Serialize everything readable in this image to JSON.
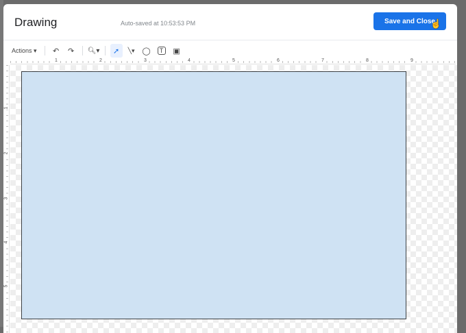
{
  "dialog": {
    "title": "Drawing",
    "autosave": "Auto-saved at 10:53:53 PM",
    "save_label": "Save and Close"
  },
  "toolbar": {
    "actions_label": "Actions ▾",
    "undo": "↶",
    "redo": "↷",
    "zoom": "🔍︎▾",
    "select": "➚",
    "line": "╲▾",
    "shape": "◯",
    "textbox": "T",
    "image": "▣"
  },
  "ruler": {
    "horizontal": [
      "1",
      "2",
      "3",
      "4",
      "5",
      "6",
      "7",
      "8",
      "9"
    ],
    "vertical": [
      "1",
      "2",
      "3",
      "4",
      "5"
    ]
  },
  "shape": {
    "fill": "#cfe2f3"
  }
}
